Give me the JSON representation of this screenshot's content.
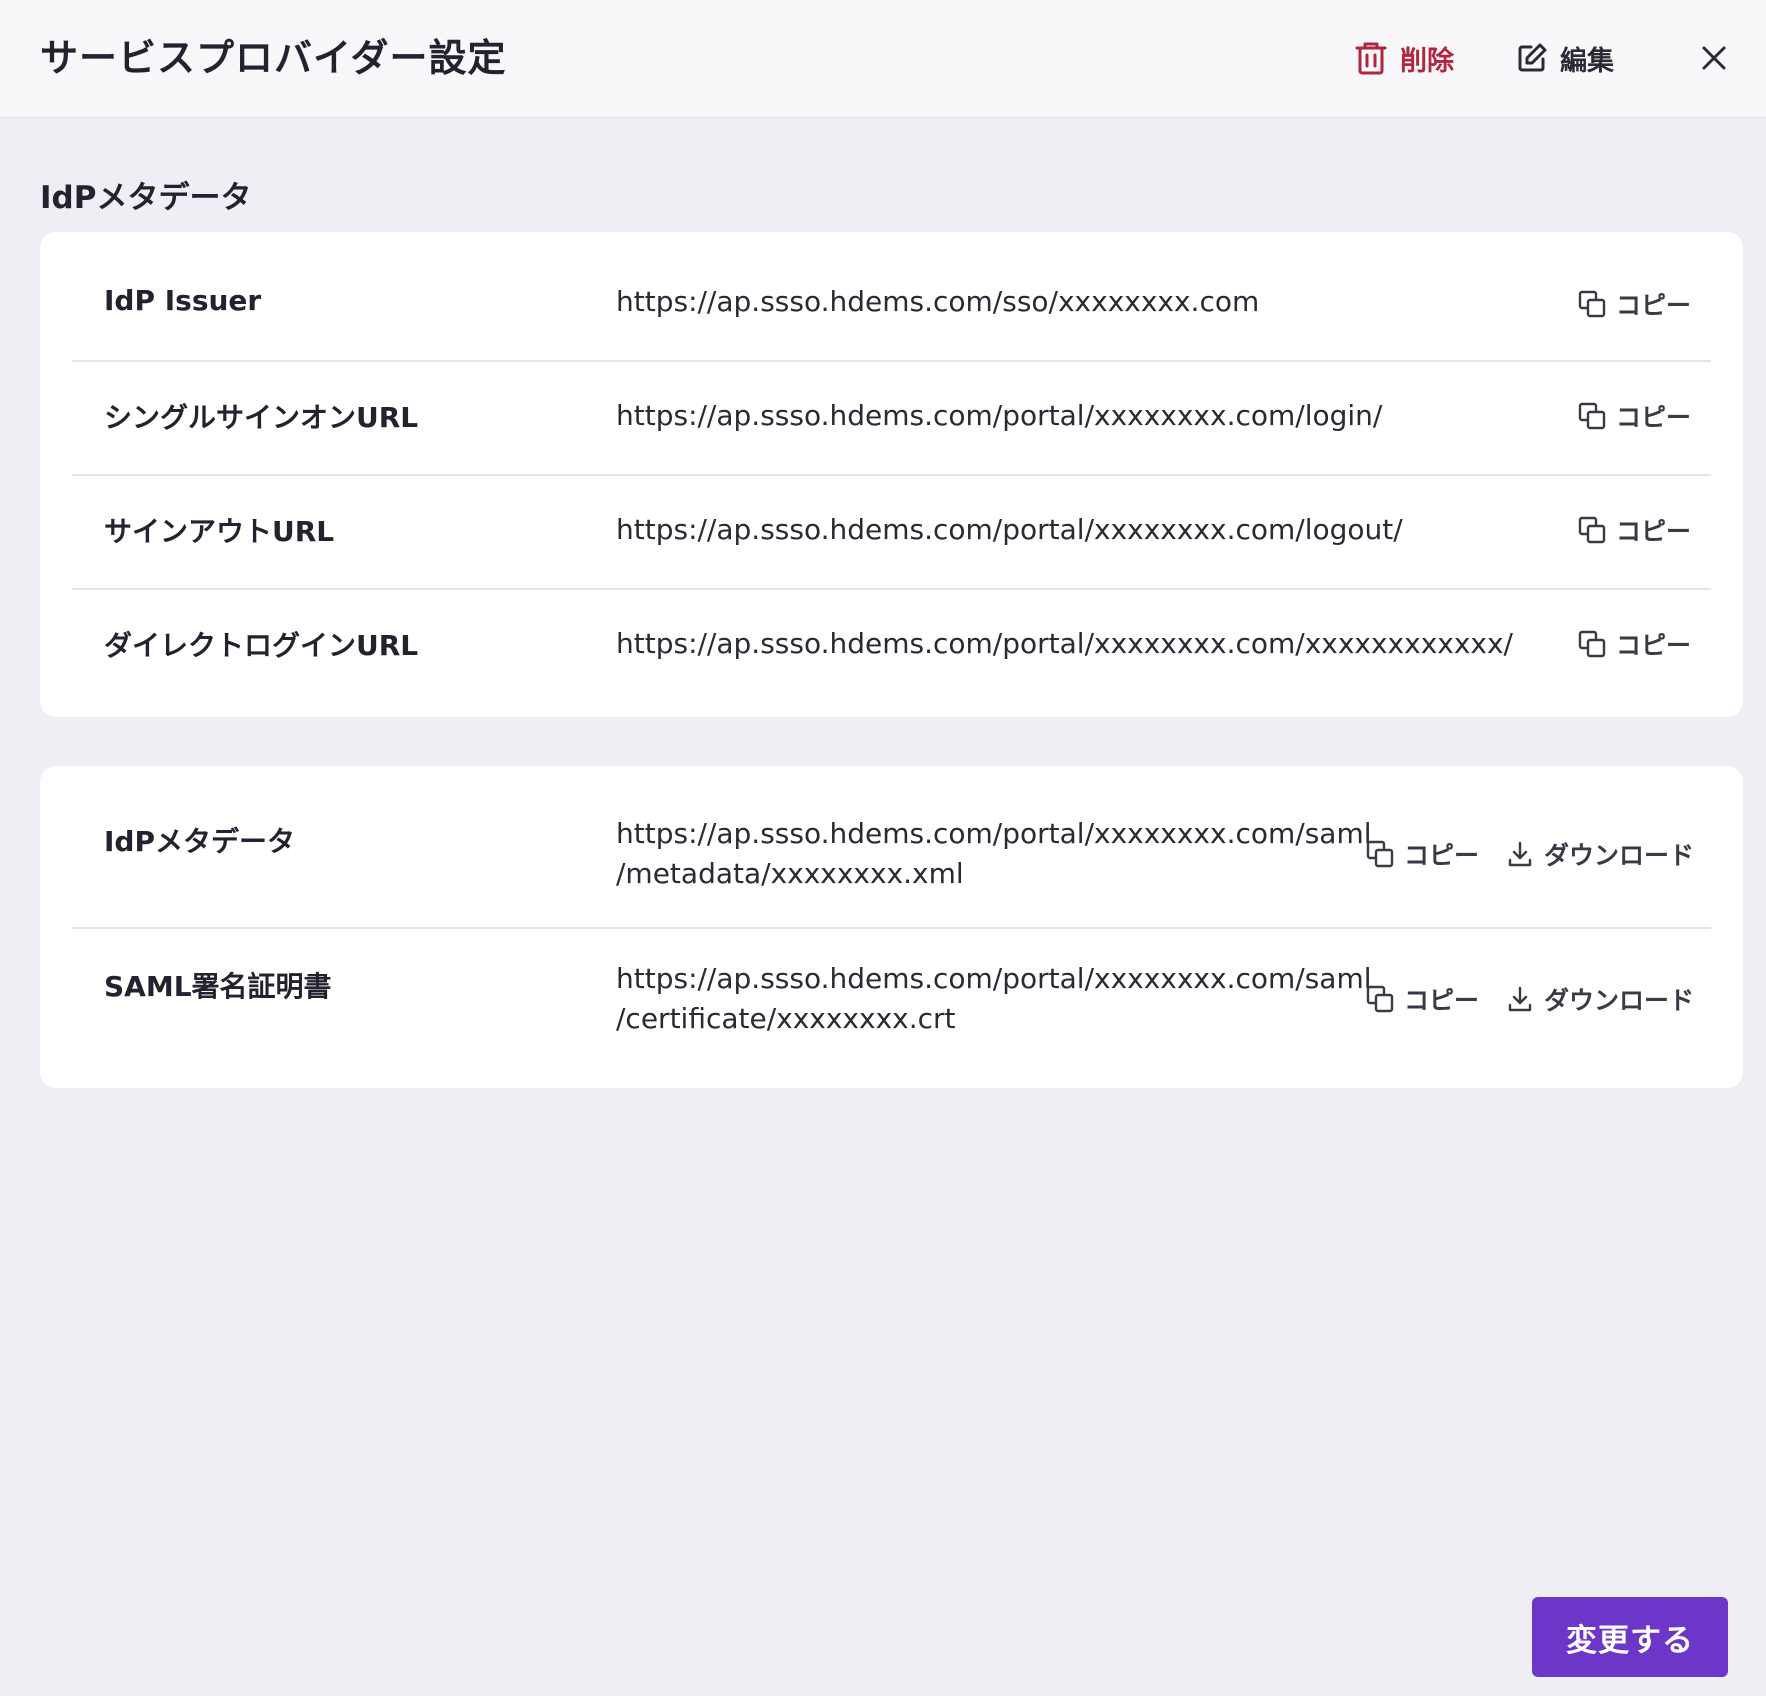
{
  "header": {
    "title": "サービスプロバイダー設定",
    "delete_label": "削除",
    "edit_label": "編集",
    "accent_delete": "#b0263f"
  },
  "section": {
    "title": "IdPメタデータ"
  },
  "card1": {
    "rows": [
      {
        "label": "IdP Issuer",
        "value": "https://ap.ssso.hdems.com/sso/xxxxxxxx.com",
        "copy_label": "コピー"
      },
      {
        "label": "シングルサインオンURL",
        "value": "https://ap.ssso.hdems.com/portal/xxxxxxxx.com/login/",
        "copy_label": "コピー"
      },
      {
        "label": "サインアウトURL",
        "value": "https://ap.ssso.hdems.com/portal/xxxxxxxx.com/logout/",
        "copy_label": "コピー"
      },
      {
        "label": "ダイレクトログインURL",
        "value": "https://ap.ssso.hdems.com/portal/xxxxxxxx.com/xxxxxxxxxxxx/",
        "copy_label": "コピー"
      }
    ]
  },
  "card2": {
    "rows": [
      {
        "label": "IdPメタデータ",
        "value_line1": "https://ap.ssso.hdems.com/portal/xxxxxxxx.com/saml",
        "value_line2": "/metadata/xxxxxxxx.xml",
        "copy_label": "コピー",
        "download_label": "ダウンロード"
      },
      {
        "label": "SAML署名証明書",
        "value_line1": "https://ap.ssso.hdems.com/portal/xxxxxxxx.com/saml",
        "value_line2": "/certificate/xxxxxxxx.crt",
        "copy_label": "コピー",
        "download_label": "ダウンロード"
      }
    ]
  },
  "footer": {
    "submit_label": "変更する",
    "accent": "#6c37c9"
  },
  "icons": [
    "trash-icon",
    "edit-icon",
    "close-icon",
    "copy-icon",
    "download-icon"
  ]
}
